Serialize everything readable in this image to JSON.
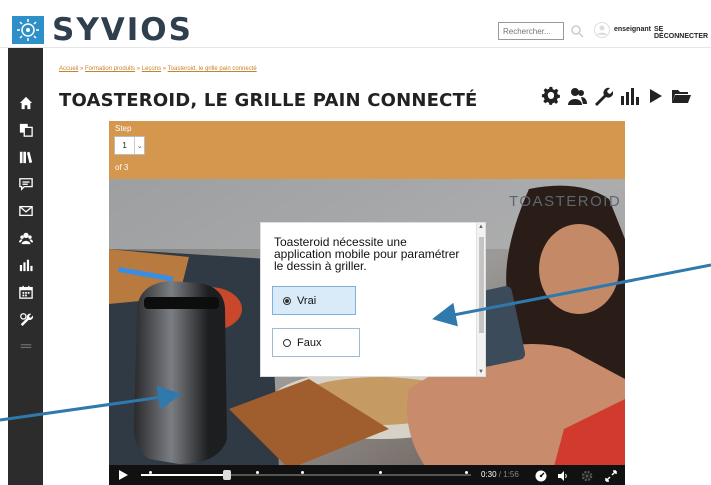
{
  "header": {
    "logo_text": "SYVIOS",
    "search_placeholder": "Rechercher...",
    "username": "enseignant",
    "logout_label": "SE DÉCONNECTER"
  },
  "sidebar": {
    "items": [
      {
        "icon": "home-icon"
      },
      {
        "icon": "copy-icon"
      },
      {
        "icon": "library-icon"
      },
      {
        "icon": "chat-icon"
      },
      {
        "icon": "mail-icon"
      },
      {
        "icon": "users-icon"
      },
      {
        "icon": "chart-icon"
      },
      {
        "icon": "calendar-icon"
      },
      {
        "icon": "tools-icon"
      },
      {
        "icon": "menu-icon"
      }
    ]
  },
  "breadcrumb": {
    "items": [
      "Accueil",
      "Formation produits",
      "Leçons",
      "Toasteroid, le grille pain connecté"
    ],
    "separator": " » "
  },
  "page_title": "TOASTEROID, LE GRILLE PAIN CONNECTÉ",
  "toolbar": {
    "icons": [
      "settings-icon",
      "users-icon",
      "wrench-icon",
      "stats-icon",
      "play-icon",
      "folder-icon"
    ]
  },
  "step": {
    "label": "Step",
    "value": "1",
    "of_text": "of 3"
  },
  "video": {
    "brand_overlay": "TOASTEROID",
    "time_current": "0:30",
    "time_separator": " / ",
    "time_total": "1:56",
    "progress": 0.26
  },
  "quiz": {
    "question": "Toasteroid nécessite une application mobile pour paramétrer le dessin à griller.",
    "options": [
      {
        "label": "Vrai",
        "selected": true
      },
      {
        "label": "Faux",
        "selected": false
      }
    ]
  },
  "colors": {
    "sidebar_bg": "#2c2c2c",
    "logo_blue": "#2e8fc9",
    "step_orange": "#d4974d",
    "arrow_blue": "#2f79ad",
    "breadcrumb": "#c7832c"
  }
}
